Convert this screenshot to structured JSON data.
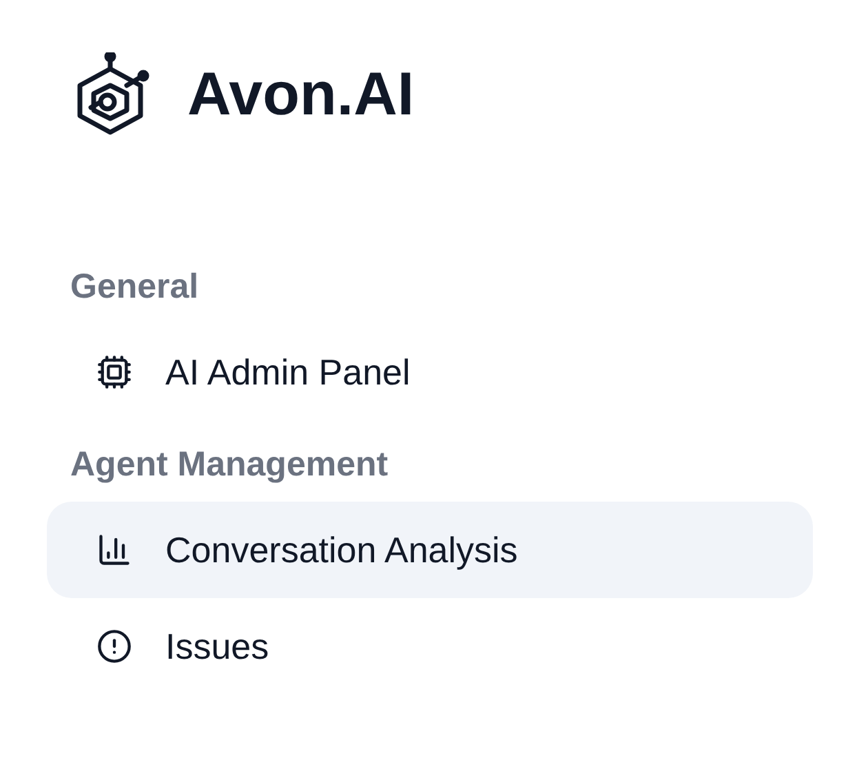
{
  "brand": {
    "name": "Avon.AI"
  },
  "sections": [
    {
      "heading": "General",
      "items": [
        {
          "label": "AI Admin Panel",
          "kind": "cpu",
          "selected": false
        }
      ]
    },
    {
      "heading": "Agent Management",
      "items": [
        {
          "label": "Conversation Analysis",
          "kind": "chart",
          "selected": true
        },
        {
          "label": "Issues",
          "kind": "alert",
          "selected": false
        }
      ]
    }
  ]
}
